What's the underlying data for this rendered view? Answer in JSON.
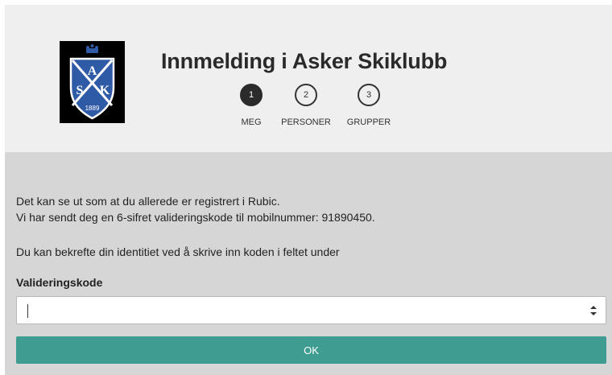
{
  "header": {
    "title": "Innmelding i Asker Skiklubb",
    "logo": {
      "letters": [
        "A",
        "S",
        "K"
      ],
      "year": "1889"
    }
  },
  "steps": [
    {
      "number": "1",
      "label": "MEG",
      "active": true
    },
    {
      "number": "2",
      "label": "PERSONER",
      "active": false
    },
    {
      "number": "3",
      "label": "GRUPPER",
      "active": false
    }
  ],
  "message": {
    "line1": "Det kan se ut som at du allerede er registrert i Rubic.",
    "line2": "Vi har sendt deg en 6-sifret valideringskode til mobilnummer: 91890450.",
    "line3": "Du kan bekrefte din identitiet ved å skrive inn koden i feltet under"
  },
  "form": {
    "label": "Valideringskode",
    "value": "",
    "submit_label": "OK"
  },
  "colors": {
    "accent": "#3e9c91",
    "header_bg": "#efefef",
    "body_bg": "#d6d6d6"
  }
}
